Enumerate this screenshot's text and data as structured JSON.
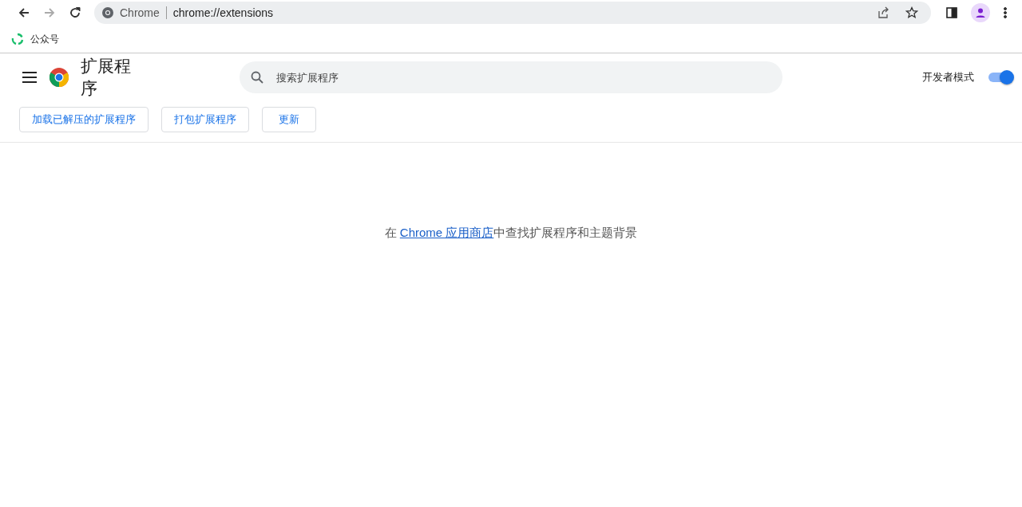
{
  "browser": {
    "back_disabled": false,
    "forward_disabled": true,
    "site_label": "Chrome",
    "url": "chrome://extensions",
    "bookmarked": false
  },
  "bookmarks": [
    {
      "label": "公众号"
    }
  ],
  "header": {
    "title": "扩展程序",
    "search": {
      "placeholder": "搜索扩展程序"
    },
    "developer_mode": {
      "label": "开发者模式",
      "on": true
    }
  },
  "actions": [
    "加载已解压的扩展程序",
    "打包扩展程序",
    "更新"
  ],
  "empty_state": {
    "before": "在 ",
    "link": "Chrome 应用商店",
    "after": "中查找扩展程序和主题背景"
  }
}
